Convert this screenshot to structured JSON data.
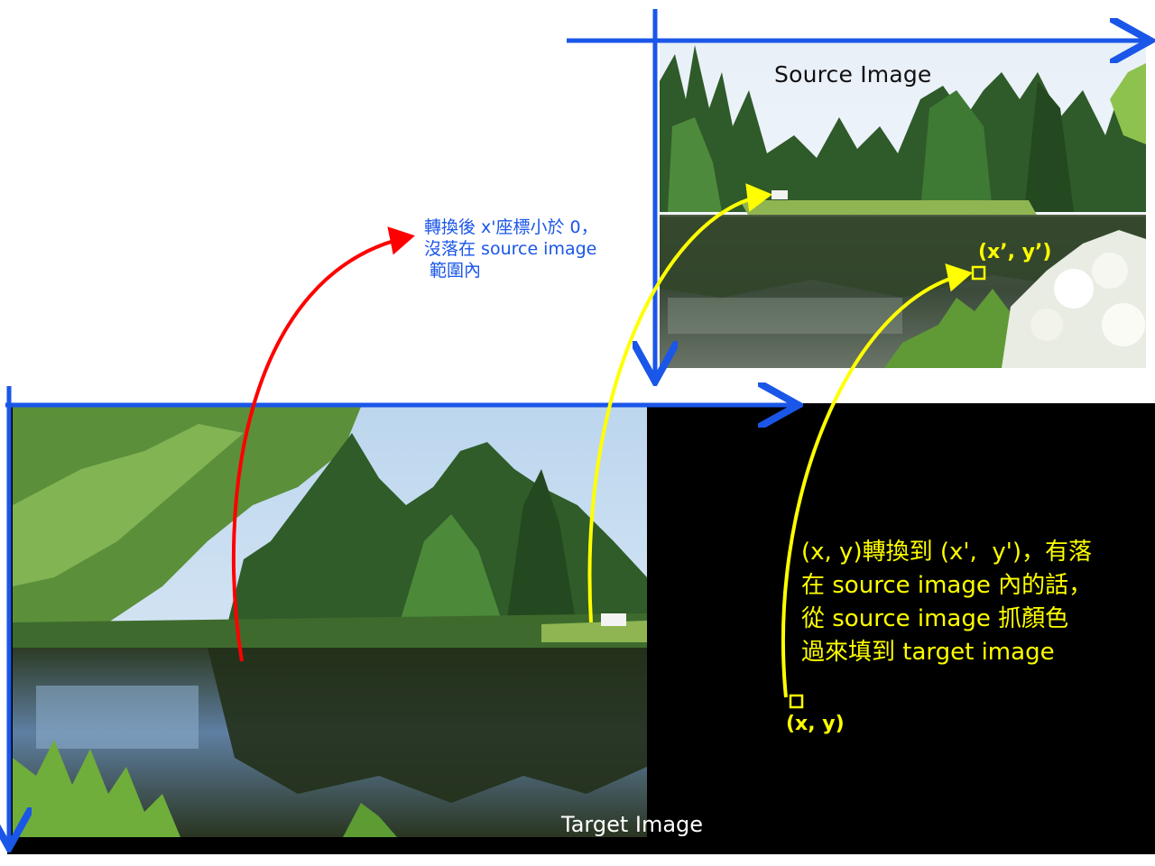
{
  "source_label": "Source Image",
  "target_label": "Target Image",
  "red_note": [
    "轉換後 x'座標小於 0，",
    "沒落在 source image",
    " 範圍內"
  ],
  "yellow_note": [
    "(x, y)轉換到 (x',  y')，有落",
    "在 source image 內的話，",
    "從 source image 抓顏色",
    "過來填到 target image"
  ],
  "source_point_label": "(x’, y’)",
  "target_point_label": "(x, y)",
  "colors": {
    "axis": "#1a56e8",
    "invalid_mapping": "#ff0000",
    "valid_mapping": "#ffff00",
    "target_background": "#000000"
  },
  "photos": {
    "source": "pond-with-conifers-and-flowers",
    "target": "pond-with-trees-and-van"
  }
}
